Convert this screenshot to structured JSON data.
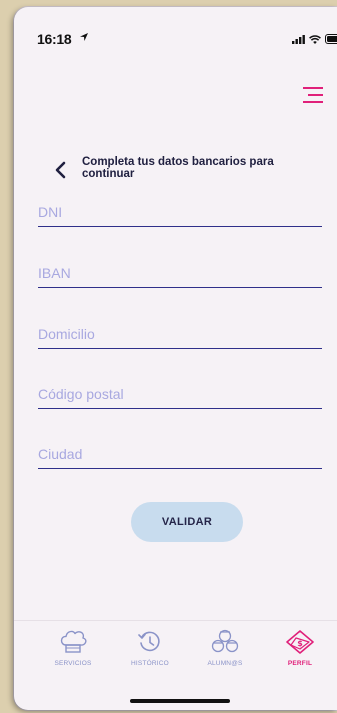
{
  "status_bar": {
    "time": "16:18"
  },
  "header": {
    "menu_icon": "hamburger-menu-icon"
  },
  "form": {
    "back_icon": "chevron-left-icon",
    "prompt": "Completa tus datos bancarios para continuar",
    "fields": [
      {
        "placeholder": "DNI"
      },
      {
        "placeholder": "IBAN"
      },
      {
        "placeholder": "Domicilio"
      },
      {
        "placeholder": "Código postal"
      },
      {
        "placeholder": "Ciudad"
      }
    ],
    "submit_label": "VALIDAR"
  },
  "tabbar": {
    "items": [
      {
        "label": "SERVICIOS",
        "icon": "chef-hat-icon"
      },
      {
        "label": "HISTÓRICO",
        "icon": "history-icon"
      },
      {
        "label": "ALUMN@S",
        "icon": "students-icon"
      },
      {
        "label": "PERFIL",
        "icon": "money-tag-icon",
        "active": true
      }
    ]
  },
  "colors": {
    "accent": "#e0207a",
    "primary_dark": "#2f2f8a",
    "placeholder": "#a8a8e0",
    "button_bg": "#c8dcee",
    "inactive_tab": "#8a93c8"
  }
}
